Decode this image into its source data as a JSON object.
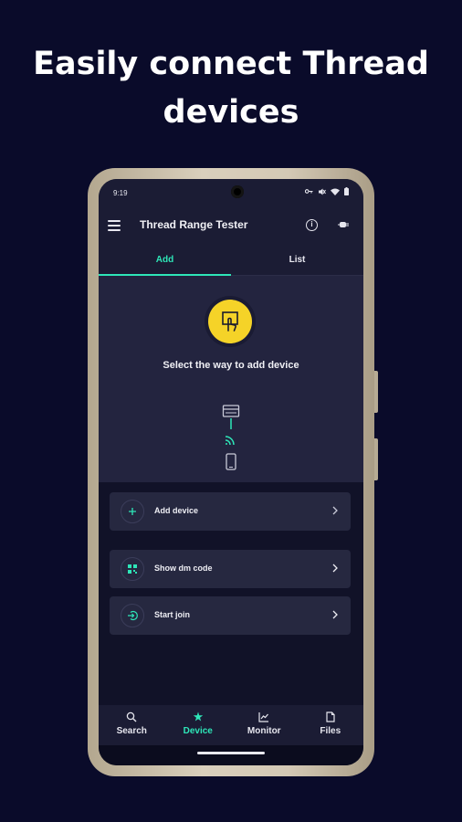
{
  "promo": {
    "headline_line1": "Easily connect Thread",
    "headline_line2": "devices"
  },
  "status_bar": {
    "time": "9:19"
  },
  "app_bar": {
    "title": "Thread Range Tester",
    "icons": [
      "menu-icon",
      "info-icon",
      "plug-icon"
    ]
  },
  "tabs": [
    {
      "label": "Add",
      "active": true
    },
    {
      "label": "List",
      "active": false
    }
  ],
  "hero": {
    "text": "Select the way to add device",
    "icons": [
      "touch-icon",
      "device-icon",
      "wifi-signal-icon",
      "phone-icon"
    ]
  },
  "options": [
    {
      "label": "Add device",
      "icon": "plus-icon"
    },
    {
      "label": "Show dm code",
      "icon": "qr-code-icon"
    },
    {
      "label": "Start join",
      "icon": "join-icon"
    }
  ],
  "bottom_nav": [
    {
      "label": "Search",
      "icon": "search-icon",
      "active": false
    },
    {
      "label": "Device",
      "icon": "device-star-icon",
      "active": true
    },
    {
      "label": "Monitor",
      "icon": "chart-icon",
      "active": false
    },
    {
      "label": "Files",
      "icon": "file-icon",
      "active": false
    }
  ],
  "colors": {
    "background": "#0a0b2a",
    "accent": "#2ee6b8",
    "yellow": "#f5d328",
    "surface": "#1b1c34",
    "card": "#262840"
  }
}
